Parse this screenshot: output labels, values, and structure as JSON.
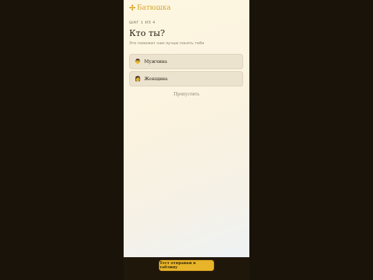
{
  "brand": {
    "icon": "orthodox-cross-icon",
    "name": "Батюшка",
    "color": "#d9a627"
  },
  "step": {
    "label": "ШАГ 1 ИЗ 4"
  },
  "question": {
    "title": "Кто ты?",
    "subtitle": "Это поможет нам лучше понять тебя"
  },
  "options": [
    {
      "emoji": "👨",
      "label": "Мужчина"
    },
    {
      "emoji": "👩",
      "label": "Женщина"
    }
  ],
  "skip": {
    "label": "Пропустить"
  },
  "footer": {
    "test_button_label": "Тест отправки в таблицу",
    "accent": "#e8b52a"
  }
}
